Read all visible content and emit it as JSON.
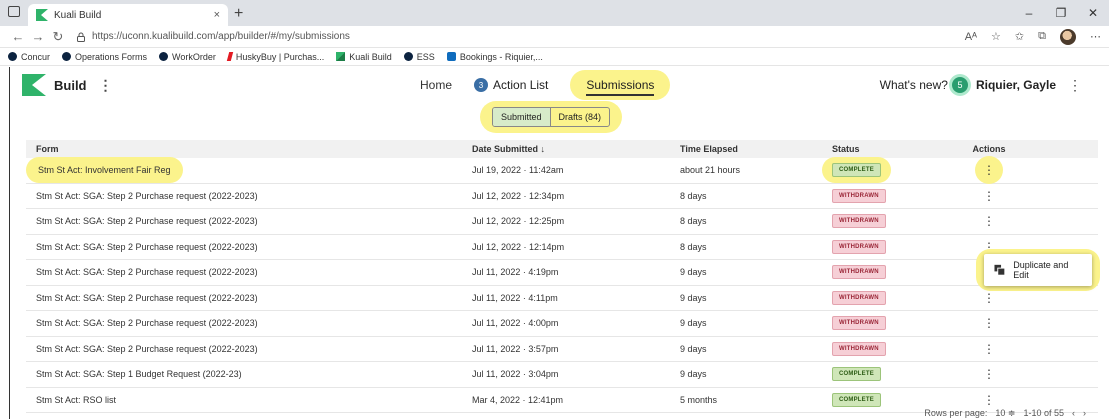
{
  "browser": {
    "tab_title": "Kuali Build",
    "new_tab": "+",
    "tab_close": "×",
    "url": "https://uconn.kualibuild.com/app/builder/#/my/submissions",
    "read_aloud": "Aᴬ",
    "window_controls": {
      "minimize": "–",
      "restore": "❐",
      "close": "✕"
    },
    "bookmarks": [
      {
        "label": "Concur",
        "icon": "uconn-icon"
      },
      {
        "label": "Operations Forms",
        "icon": "uconn-icon"
      },
      {
        "label": "WorkOrder",
        "icon": "uconn-icon"
      },
      {
        "label": "HuskyBuy | Purchas...",
        "icon": "huskybuy-icon"
      },
      {
        "label": "Kuali Build",
        "icon": "kuali-icon"
      },
      {
        "label": "ESS",
        "icon": "uconn-icon"
      },
      {
        "label": "Bookings - Riquier,...",
        "icon": "bookings-icon"
      }
    ]
  },
  "app": {
    "brand": "Build",
    "nav": {
      "home": "Home",
      "action_list": "Action List",
      "action_count": "3",
      "submissions": "Submissions"
    },
    "whats_new": "What's new?",
    "whats_new_count": "5",
    "user": "Riquier, Gayle",
    "toggle": {
      "submitted": "Submitted",
      "drafts": "Drafts (84)"
    },
    "highlight_color": "#fbf38c"
  },
  "table": {
    "headers": {
      "form": "Form",
      "date": "Date Submitted ↓",
      "time": "Time Elapsed",
      "status": "Status",
      "actions": "Actions"
    },
    "rows": [
      {
        "form": "Stm St Act: Involvement Fair Reg",
        "date": "Jul 19, 2022 · 11:42am",
        "time": "about 21 hours",
        "status": "COMPLETE"
      },
      {
        "form": "Stm St Act: SGA: Step 2 Purchase request (2022-2023)",
        "date": "Jul 12, 2022 · 12:34pm",
        "time": "8 days",
        "status": "WITHDRAWN"
      },
      {
        "form": "Stm St Act: SGA: Step 2 Purchase request (2022-2023)",
        "date": "Jul 12, 2022 · 12:25pm",
        "time": "8 days",
        "status": "WITHDRAWN"
      },
      {
        "form": "Stm St Act: SGA: Step 2 Purchase request (2022-2023)",
        "date": "Jul 12, 2022 · 12:14pm",
        "time": "8 days",
        "status": "WITHDRAWN"
      },
      {
        "form": "Stm St Act: SGA: Step 2 Purchase request (2022-2023)",
        "date": "Jul 11, 2022 · 4:19pm",
        "time": "9 days",
        "status": "WITHDRAWN"
      },
      {
        "form": "Stm St Act: SGA: Step 2 Purchase request (2022-2023)",
        "date": "Jul 11, 2022 · 4:11pm",
        "time": "9 days",
        "status": "WITHDRAWN"
      },
      {
        "form": "Stm St Act: SGA: Step 2 Purchase request (2022-2023)",
        "date": "Jul 11, 2022 · 4:00pm",
        "time": "9 days",
        "status": "WITHDRAWN"
      },
      {
        "form": "Stm St Act: SGA: Step 2 Purchase request (2022-2023)",
        "date": "Jul 11, 2022 · 3:57pm",
        "time": "9 days",
        "status": "WITHDRAWN"
      },
      {
        "form": "Stm St Act: SGA: Step 1 Budget Request (2022-23)",
        "date": "Jul 11, 2022 · 3:04pm",
        "time": "9 days",
        "status": "COMPLETE"
      },
      {
        "form": "Stm St Act: RSO list",
        "date": "Mar 4, 2022 · 12:41pm",
        "time": "5 months",
        "status": "COMPLETE"
      }
    ],
    "row_menu": "⋮",
    "popup": {
      "label": "Duplicate and Edit"
    },
    "pager": {
      "rows_label": "Rows per page:",
      "rows_value": "10 ≑",
      "range": "1-10 of 55",
      "prev": "‹",
      "next": "›"
    }
  }
}
